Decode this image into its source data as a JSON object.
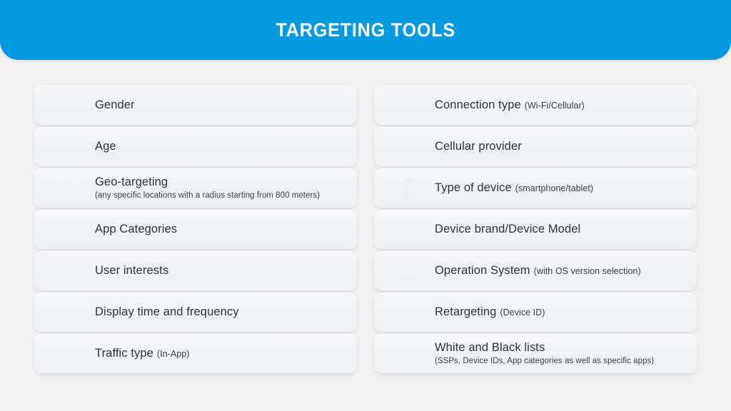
{
  "header": {
    "title": "TARGETING TOOLS",
    "background_color": "#029ade",
    "title_color": "#ffffff"
  },
  "page": {
    "background_color": "#f2f2f3",
    "card_color": "#f2f3f6",
    "text_color": "#2f3234",
    "icon_color": "#8d9299"
  },
  "columns": [
    {
      "name": "left-column",
      "rows": [
        {
          "icon": "gender-symbols-icon",
          "label": "Gender",
          "inline_note": "",
          "subtitle": ""
        },
        {
          "icon": "people-ages-icon",
          "label": "Age",
          "inline_note": "",
          "subtitle": ""
        },
        {
          "icon": "map-pin-icon",
          "label": "Geo-targeting",
          "inline_note": "",
          "subtitle": "(any specific locations with a radius starting from 800 meters)"
        },
        {
          "icon": "app-grid-phone-icon",
          "label": "App Categories",
          "inline_note": "",
          "subtitle": ""
        },
        {
          "icon": "puzzle-piece-icon",
          "label": "User interests",
          "inline_note": "",
          "subtitle": ""
        },
        {
          "icon": "hourglass-icon",
          "label": "Display time and frequency",
          "inline_note": "",
          "subtitle": ""
        },
        {
          "icon": "traffic-search-icon",
          "label": "Traffic type",
          "inline_note": "(In-App)",
          "subtitle": ""
        }
      ]
    },
    {
      "name": "right-column",
      "rows": [
        {
          "icon": "wifi-icon",
          "label": "Connection type",
          "inline_note": "(Wi-Fi/Cellular)",
          "subtitle": ""
        },
        {
          "icon": "cell-tower-icon",
          "label": "Cellular provider",
          "inline_note": "",
          "subtitle": ""
        },
        {
          "icon": "smartphone-icon",
          "label": "Type of device",
          "inline_note": "(smartphone/tablet)",
          "subtitle": ""
        },
        {
          "icon": "apple-icon",
          "label": "Device brand/Device Model",
          "inline_note": "",
          "subtitle": ""
        },
        {
          "icon": "android-os-icon",
          "label": "Operation System",
          "inline_note": "(with OS version selection)",
          "subtitle": ""
        },
        {
          "icon": "target-bullseye-icon",
          "label": "Retargeting",
          "inline_note": "(Device ID)",
          "subtitle": ""
        },
        {
          "icon": "list-icon",
          "label": "White and Black lists",
          "inline_note": "",
          "subtitle": "(SSPs, Device IDs, App categories as well as specific apps)"
        }
      ]
    }
  ]
}
